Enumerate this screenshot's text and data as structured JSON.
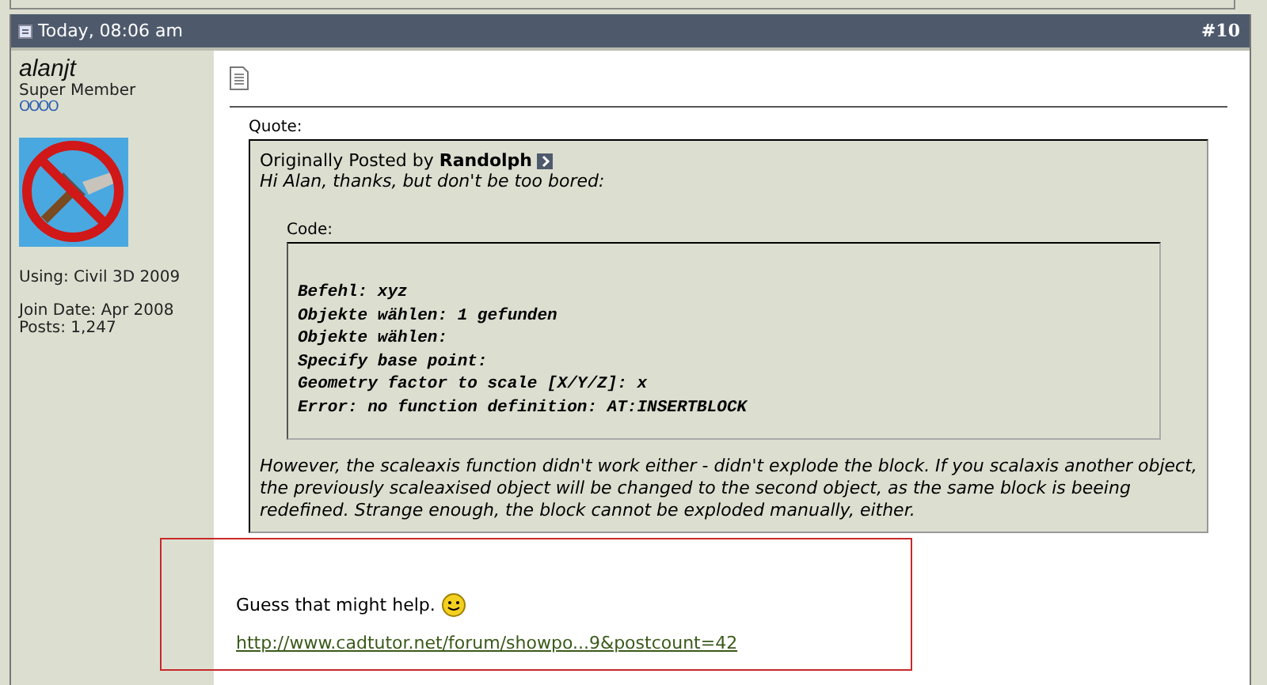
{
  "post": {
    "date": "Today, 08:06 am",
    "number": "#10"
  },
  "author": {
    "name": "alanjt",
    "title": "Super Member",
    "rank": "OOOO",
    "using": "Using: Civil 3D 2009",
    "join_date": "Join Date: Apr 2008",
    "posts": "Posts: 1,247"
  },
  "quote": {
    "label": "Quote:",
    "posted_by_prefix": "Originally Posted by",
    "posted_by": "Randolph",
    "intro": "Hi Alan, thanks, but don't be too bored:",
    "code_label": "Code:",
    "code_lines": [
      "Befehl: xyz",
      "Objekte wählen: 1 gefunden",
      "Objekte wählen:",
      "Specify base point:",
      "Geometry factor to scale [X/Y/Z]: x",
      "Error: no function definition: AT:INSERTBLOCK"
    ],
    "outro": "However, the scaleaxis function didn't work either - didn't explode the block. If you scalaxis another object, the previously scaleaxised object will be changed to the second object, as the same block is beeing redefined. Strange enough, the block cannot be exploded manually, either."
  },
  "message": "Guess that might help.",
  "link": "http://www.cadtutor.net/forum/showpo...9&postcount=42"
}
